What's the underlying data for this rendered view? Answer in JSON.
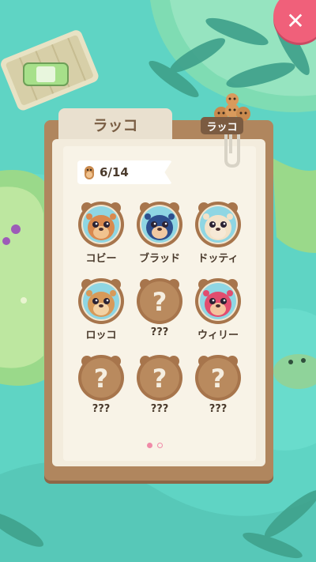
{
  "header": {
    "close_icon": "close-icon"
  },
  "book": {
    "tab_title": "ラッコ",
    "clip_label": "ラッコ",
    "counter": "6/14"
  },
  "otters": [
    {
      "name": "コビー",
      "unlocked": true,
      "fur": "#d9894e",
      "belly": "#f1c38f",
      "ring": "#8fd6e3"
    },
    {
      "name": "ブラッド",
      "unlocked": true,
      "fur": "#2e4f8d",
      "belly": "#f1c9a2",
      "ring": "#8fd6e3"
    },
    {
      "name": "ドッティ",
      "unlocked": true,
      "fur": "#f3e2c8",
      "belly": "#f6e9d6",
      "ring": "#8fd6e3"
    },
    {
      "name": "ロッコ",
      "unlocked": true,
      "fur": "#d79a5a",
      "belly": "#f3d2a4",
      "ring": "#8fd6e3"
    },
    {
      "name": "???",
      "unlocked": false
    },
    {
      "name": "ウィリー",
      "unlocked": true,
      "fur": "#e24d6f",
      "belly": "#f4c49e",
      "ring": "#8fd6e3"
    },
    {
      "name": "???",
      "unlocked": false
    },
    {
      "name": "???",
      "unlocked": false
    },
    {
      "name": "???",
      "unlocked": false
    }
  ],
  "pager": {
    "pages": 2,
    "current": 1
  },
  "colors": {
    "board": "#b0865e",
    "paper": "#f3ecdd",
    "locked": "#a7754c",
    "accent": "#f0607a"
  }
}
